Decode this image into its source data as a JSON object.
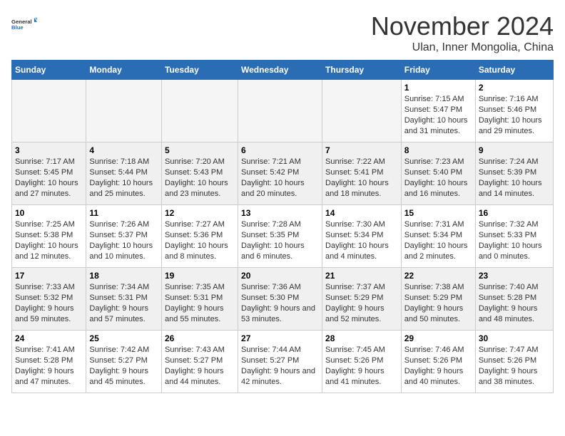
{
  "logo": {
    "line1": "General",
    "line2": "Blue"
  },
  "title": "November 2024",
  "subtitle": "Ulan, Inner Mongolia, China",
  "days_of_week": [
    "Sunday",
    "Monday",
    "Tuesday",
    "Wednesday",
    "Thursday",
    "Friday",
    "Saturday"
  ],
  "weeks": [
    [
      {
        "day": "",
        "empty": true
      },
      {
        "day": "",
        "empty": true
      },
      {
        "day": "",
        "empty": true
      },
      {
        "day": "",
        "empty": true
      },
      {
        "day": "",
        "empty": true
      },
      {
        "day": "1",
        "info": "Sunrise: 7:15 AM\nSunset: 5:47 PM\nDaylight: 10 hours and 31 minutes."
      },
      {
        "day": "2",
        "info": "Sunrise: 7:16 AM\nSunset: 5:46 PM\nDaylight: 10 hours and 29 minutes."
      }
    ],
    [
      {
        "day": "3",
        "info": "Sunrise: 7:17 AM\nSunset: 5:45 PM\nDaylight: 10 hours and 27 minutes."
      },
      {
        "day": "4",
        "info": "Sunrise: 7:18 AM\nSunset: 5:44 PM\nDaylight: 10 hours and 25 minutes."
      },
      {
        "day": "5",
        "info": "Sunrise: 7:20 AM\nSunset: 5:43 PM\nDaylight: 10 hours and 23 minutes."
      },
      {
        "day": "6",
        "info": "Sunrise: 7:21 AM\nSunset: 5:42 PM\nDaylight: 10 hours and 20 minutes."
      },
      {
        "day": "7",
        "info": "Sunrise: 7:22 AM\nSunset: 5:41 PM\nDaylight: 10 hours and 18 minutes."
      },
      {
        "day": "8",
        "info": "Sunrise: 7:23 AM\nSunset: 5:40 PM\nDaylight: 10 hours and 16 minutes."
      },
      {
        "day": "9",
        "info": "Sunrise: 7:24 AM\nSunset: 5:39 PM\nDaylight: 10 hours and 14 minutes."
      }
    ],
    [
      {
        "day": "10",
        "info": "Sunrise: 7:25 AM\nSunset: 5:38 PM\nDaylight: 10 hours and 12 minutes."
      },
      {
        "day": "11",
        "info": "Sunrise: 7:26 AM\nSunset: 5:37 PM\nDaylight: 10 hours and 10 minutes."
      },
      {
        "day": "12",
        "info": "Sunrise: 7:27 AM\nSunset: 5:36 PM\nDaylight: 10 hours and 8 minutes."
      },
      {
        "day": "13",
        "info": "Sunrise: 7:28 AM\nSunset: 5:35 PM\nDaylight: 10 hours and 6 minutes."
      },
      {
        "day": "14",
        "info": "Sunrise: 7:30 AM\nSunset: 5:34 PM\nDaylight: 10 hours and 4 minutes."
      },
      {
        "day": "15",
        "info": "Sunrise: 7:31 AM\nSunset: 5:34 PM\nDaylight: 10 hours and 2 minutes."
      },
      {
        "day": "16",
        "info": "Sunrise: 7:32 AM\nSunset: 5:33 PM\nDaylight: 10 hours and 0 minutes."
      }
    ],
    [
      {
        "day": "17",
        "info": "Sunrise: 7:33 AM\nSunset: 5:32 PM\nDaylight: 9 hours and 59 minutes."
      },
      {
        "day": "18",
        "info": "Sunrise: 7:34 AM\nSunset: 5:31 PM\nDaylight: 9 hours and 57 minutes."
      },
      {
        "day": "19",
        "info": "Sunrise: 7:35 AM\nSunset: 5:31 PM\nDaylight: 9 hours and 55 minutes."
      },
      {
        "day": "20",
        "info": "Sunrise: 7:36 AM\nSunset: 5:30 PM\nDaylight: 9 hours and 53 minutes."
      },
      {
        "day": "21",
        "info": "Sunrise: 7:37 AM\nSunset: 5:29 PM\nDaylight: 9 hours and 52 minutes."
      },
      {
        "day": "22",
        "info": "Sunrise: 7:38 AM\nSunset: 5:29 PM\nDaylight: 9 hours and 50 minutes."
      },
      {
        "day": "23",
        "info": "Sunrise: 7:40 AM\nSunset: 5:28 PM\nDaylight: 9 hours and 48 minutes."
      }
    ],
    [
      {
        "day": "24",
        "info": "Sunrise: 7:41 AM\nSunset: 5:28 PM\nDaylight: 9 hours and 47 minutes."
      },
      {
        "day": "25",
        "info": "Sunrise: 7:42 AM\nSunset: 5:27 PM\nDaylight: 9 hours and 45 minutes."
      },
      {
        "day": "26",
        "info": "Sunrise: 7:43 AM\nSunset: 5:27 PM\nDaylight: 9 hours and 44 minutes."
      },
      {
        "day": "27",
        "info": "Sunrise: 7:44 AM\nSunset: 5:27 PM\nDaylight: 9 hours and 42 minutes."
      },
      {
        "day": "28",
        "info": "Sunrise: 7:45 AM\nSunset: 5:26 PM\nDaylight: 9 hours and 41 minutes."
      },
      {
        "day": "29",
        "info": "Sunrise: 7:46 AM\nSunset: 5:26 PM\nDaylight: 9 hours and 40 minutes."
      },
      {
        "day": "30",
        "info": "Sunrise: 7:47 AM\nSunset: 5:26 PM\nDaylight: 9 hours and 38 minutes."
      }
    ]
  ]
}
